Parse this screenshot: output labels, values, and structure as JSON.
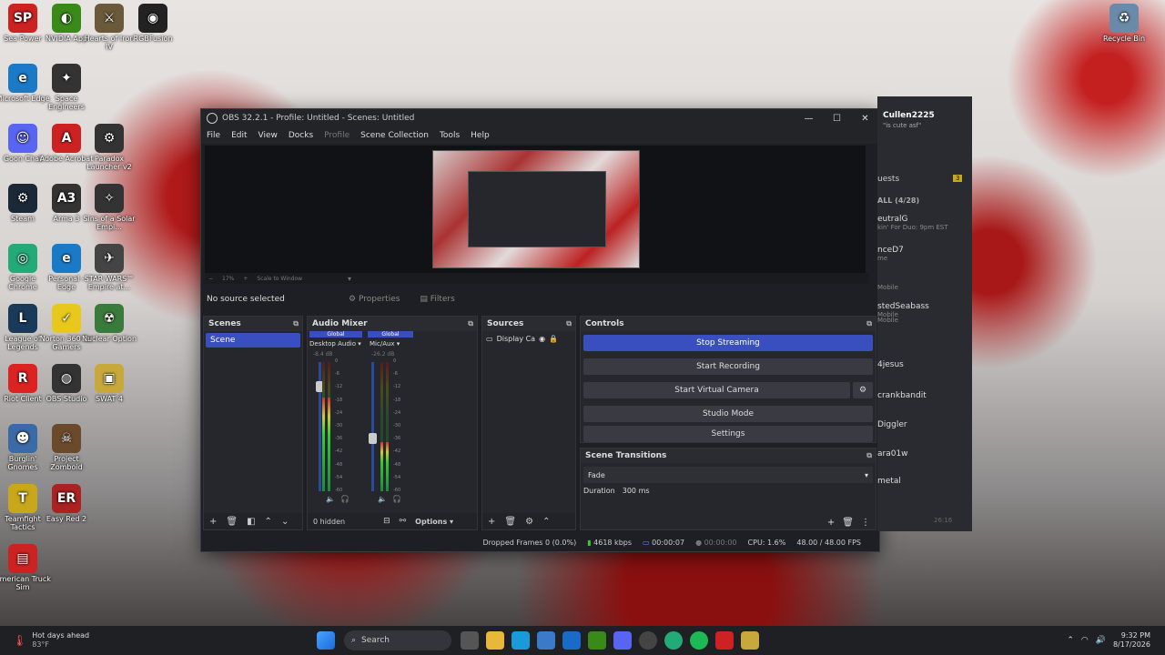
{
  "desktop_icons": [
    {
      "label": "Sea Power",
      "color": "#c22",
      "glyph": "SP"
    },
    {
      "label": "NVIDIA App",
      "color": "#3a8a1a",
      "glyph": "◐"
    },
    {
      "label": "Hearts of Iron IV",
      "color": "#6a5a3a",
      "glyph": "⚔"
    },
    {
      "label": "RGBFusion",
      "color": "#222",
      "glyph": "◉"
    },
    {
      "label": "Microsoft Edge",
      "color": "#1a7ac8",
      "glyph": "e"
    },
    {
      "label": "Space Engineers",
      "color": "#333",
      "glyph": "✦"
    },
    {
      "label": "Goon Chat",
      "color": "#5865f2",
      "glyph": "☺"
    },
    {
      "label": "Adobe Acrobat",
      "color": "#c22",
      "glyph": "A"
    },
    {
      "label": "Paradox Launcher v2",
      "color": "#333",
      "glyph": "⚙"
    },
    {
      "label": "Steam",
      "color": "#1b2838",
      "glyph": "⚙"
    },
    {
      "label": "Arma 3",
      "color": "#333",
      "glyph": "A3"
    },
    {
      "label": "Sins of a Solar Empi...",
      "color": "#333",
      "glyph": "✧"
    },
    {
      "label": "Google Chrome",
      "color": "#2a7",
      "glyph": "◎"
    },
    {
      "label": "Personal - Edge",
      "color": "#1a7ac8",
      "glyph": "e"
    },
    {
      "label": "STAR WARS™ Empire at...",
      "color": "#444",
      "glyph": "✈"
    },
    {
      "label": "League of Legends",
      "color": "#1a3a5a",
      "glyph": "L"
    },
    {
      "label": "Norton 360 for Gamers",
      "color": "#e8c81a",
      "glyph": "✓"
    },
    {
      "label": "Nuclear Option",
      "color": "#3a7a3a",
      "glyph": "☢"
    },
    {
      "label": "Riot Client",
      "color": "#d22",
      "glyph": "R"
    },
    {
      "label": "OBS Studio",
      "color": "#333",
      "glyph": "◍"
    },
    {
      "label": "SWAT 4",
      "color": "#c8a83a",
      "glyph": "▣"
    },
    {
      "label": "Burglin' Gnomes",
      "color": "#3a6aa8",
      "glyph": "☻"
    },
    {
      "label": "Project Zomboid",
      "color": "#6a4a2a",
      "glyph": "☠"
    },
    {
      "label": "Teamfight Tactics",
      "color": "#c8a81a",
      "glyph": "T"
    },
    {
      "label": "Easy Red 2",
      "color": "#a22",
      "glyph": "ER"
    },
    {
      "label": "American Truck Sim",
      "color": "#c22",
      "glyph": "▤"
    },
    {
      "label": "Recycle Bin",
      "color": "#6a8aaa",
      "glyph": "♻"
    }
  ],
  "obs": {
    "title": "OBS 32.2.1 - Profile: Untitled - Scenes: Untitled",
    "menu": [
      "File",
      "Edit",
      "View",
      "Docks",
      "Profile",
      "Scene Collection",
      "Tools",
      "Help"
    ],
    "zoom_value": "17%",
    "zoom_mode": "Scale to Window",
    "no_source": "No source selected",
    "properties_label": "Properties",
    "filters_label": "Filters",
    "scenes": {
      "title": "Scenes",
      "items": [
        "Scene"
      ]
    },
    "audio": {
      "title": "Audio Mixer",
      "channels": [
        {
          "global": "Global",
          "name": "Desktop Audio",
          "db": "-8.4 dB",
          "level": 0.15
        },
        {
          "global": "Global",
          "name": "Mic/Aux",
          "db": "-26.2 dB",
          "level": 0.55
        }
      ],
      "ticks": [
        "0",
        "-6",
        "-12",
        "-18",
        "-24",
        "-30",
        "-36",
        "-42",
        "-48",
        "-54",
        "-60"
      ],
      "hidden": "0 hidden",
      "options": "Options"
    },
    "sources": {
      "title": "Sources",
      "items": [
        "Display Ca"
      ]
    },
    "controls": {
      "title": "Controls",
      "stop_streaming": "Stop Streaming",
      "start_recording": "Start Recording",
      "start_virtual_camera": "Start Virtual Camera",
      "studio_mode": "Studio Mode",
      "settings": "Settings"
    },
    "transitions": {
      "title": "Scene Transitions",
      "type": "Fade",
      "duration_label": "Duration",
      "duration": "300 ms"
    },
    "status": {
      "dropped": "Dropped Frames 0 (0.0%)",
      "bitrate": "4618 kbps",
      "stream_time": "00:00:07",
      "rec_time": "00:00:00",
      "cpu": "CPU: 1.6%",
      "fps": "48.00 / 48.00 FPS"
    }
  },
  "side_panel": {
    "user": "Cullen2225",
    "status": "\"is cute asf\"",
    "quests": "uests",
    "quests_badge": "3",
    "group": "ALL (4/28)",
    "rows": [
      {
        "name": "eutralG",
        "sub": "kin' For Duo: 9pm EST"
      },
      {
        "name": "nceD7",
        "sub": "me"
      },
      {
        "name": "",
        "sub": "Mobile"
      },
      {
        "name": "stedSeabass",
        "sub": "Mobile"
      },
      {
        "name": "",
        "sub": "Mobile"
      },
      {
        "name": "4jesus",
        "sub": ""
      },
      {
        "name": "crankbandit",
        "sub": ""
      },
      {
        "name": "Diggler",
        "sub": ""
      },
      {
        "name": "ara01w",
        "sub": ""
      },
      {
        "name": "metal",
        "sub": ""
      }
    ],
    "time": "26:16"
  },
  "taskbar": {
    "weather_title": "Hot days ahead",
    "weather_temp": "83°F",
    "search_label": "Search",
    "clock_time": "9:32 PM",
    "clock_date": "8/17/2026"
  }
}
